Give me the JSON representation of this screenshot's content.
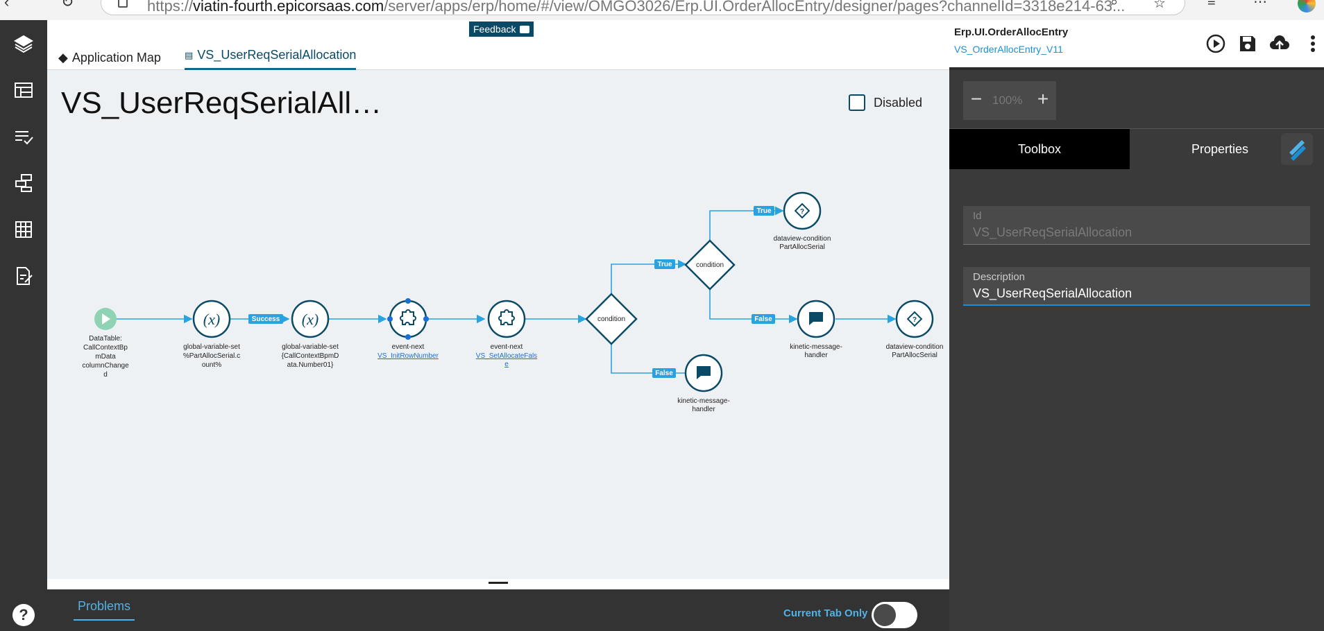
{
  "browser": {
    "url_prefix": "https://",
    "url_host": "viatin-fourth.epicorsaas.com",
    "url_path": "/server/apps/erp/home/#/view/OMGO3026/Erp.UI.OrderAllocEntry/designer/pages?channelId=3318e214-63..."
  },
  "tabs": {
    "app_map": "Application Map",
    "active": "VS_UserReqSerialAllocation"
  },
  "feedback_label": "Feedback",
  "canvas": {
    "title": "VS_UserReqSerialAll…",
    "disabled_label": "Disabled"
  },
  "flow": {
    "start": {
      "label_lines": [
        "DataTable:",
        "CallContextBp",
        "mData",
        "columnChange",
        "d"
      ]
    },
    "gvs1": {
      "symbol": "(x)",
      "label_lines": [
        "global-variable-set",
        "%PartAllocSerial.c",
        "ount%"
      ]
    },
    "gvs2": {
      "symbol": "(x)",
      "label_lines": [
        "global-variable-set",
        "{CallContextBpmD",
        "ata.Number01}"
      ]
    },
    "en1": {
      "label": "event-next",
      "link": "VS_InitRowNumber"
    },
    "en2": {
      "label": "event-next",
      "link_lines": [
        "VS_SetAllocateFals",
        "e"
      ]
    },
    "cond1": {
      "label": "condition"
    },
    "cond2": {
      "label": "condition"
    },
    "dvc1": {
      "label_lines": [
        "dataview-condition",
        "PartAllocSerial"
      ]
    },
    "kmh1": {
      "label_lines": [
        "kinetic-message-",
        "handler"
      ]
    },
    "dvc2": {
      "label_lines": [
        "dataview-condition",
        "PartAllocSerial"
      ]
    },
    "kmh2": {
      "label_lines": [
        "kinetic-message-",
        "handler"
      ]
    },
    "badges": {
      "success": "Success",
      "true1": "True",
      "true2": "True",
      "false1": "False",
      "false2": "False"
    }
  },
  "bottom": {
    "problems": "Problems",
    "current_tab_only": "Current Tab Only"
  },
  "right": {
    "app_name": "Erp.UI.OrderAllocEntry",
    "app_version": "VS_OrderAllocEntry_V11",
    "zoom_minus": "−",
    "zoom_value": "100%",
    "zoom_plus": "+",
    "tab_toolbox": "Toolbox",
    "tab_properties": "Properties",
    "id_label": "Id",
    "id_value": "VS_UserReqSerialAllocation",
    "desc_label": "Description",
    "desc_value": "VS_UserReqSerialAllocation"
  },
  "help": "?",
  "colors": {
    "accent": "#0b4a66",
    "link": "#1a8fd6",
    "badge": "#29a3e0",
    "start": "#8fd3b4"
  }
}
